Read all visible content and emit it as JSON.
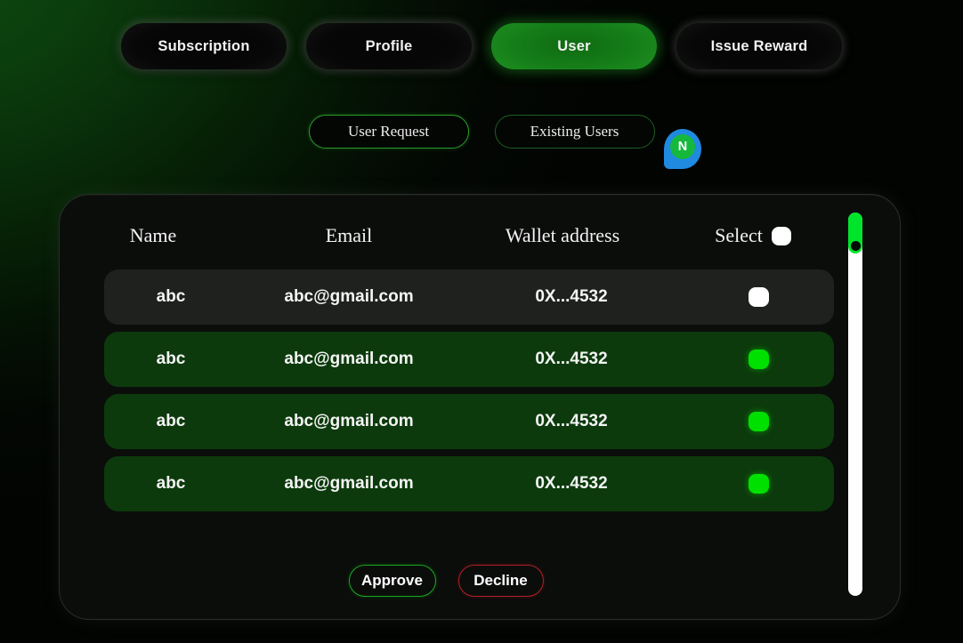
{
  "tabs": [
    {
      "label": "Subscription",
      "active": false
    },
    {
      "label": "Profile",
      "active": false
    },
    {
      "label": "User",
      "active": true
    },
    {
      "label": "Issue Reward",
      "active": false
    }
  ],
  "subnav": [
    {
      "label": "User Request",
      "active": true
    },
    {
      "label": "Existing Users",
      "active": false
    }
  ],
  "notification_badge": {
    "letter": "N",
    "pin_color": "#1f8ae0",
    "dot_color": "#15b83c"
  },
  "table": {
    "columns": [
      "Name",
      "Email",
      "Wallet address",
      "Select"
    ],
    "select_all_checked": false,
    "rows": [
      {
        "name": "abc",
        "email": "abc@gmail.com",
        "wallet": "0X...4532",
        "selected": false
      },
      {
        "name": "abc",
        "email": "abc@gmail.com",
        "wallet": "0X...4532",
        "selected": true
      },
      {
        "name": "abc",
        "email": "abc@gmail.com",
        "wallet": "0X...4532",
        "selected": true
      },
      {
        "name": "abc",
        "email": "abc@gmail.com",
        "wallet": "0X...4532",
        "selected": true
      }
    ]
  },
  "scrollbar": {
    "track_color": "#ffffff",
    "thumb_color": "#00e52b",
    "thumb_position_percent": 0
  },
  "actions": {
    "approve_label": "Approve",
    "decline_label": "Decline",
    "approve_color": "#18a81c",
    "decline_color": "#b21f28"
  },
  "theme": {
    "accent_green": "#00e000",
    "active_tab_green": "#1d8e20",
    "selected_row_green": "#0c3a0c",
    "unselected_row_gray": "#1e211e",
    "background": "#050705"
  }
}
